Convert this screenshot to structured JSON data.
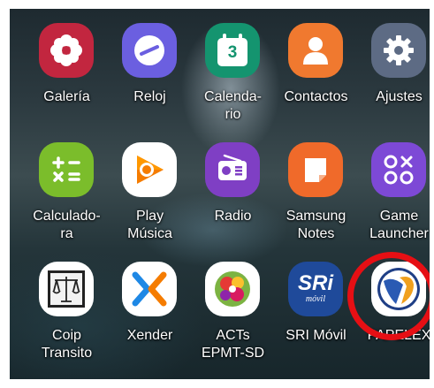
{
  "apps": [
    {
      "label": "Galería",
      "icon": "flower-icon",
      "bg": "#c2263f"
    },
    {
      "label": "Reloj",
      "icon": "clock-icon",
      "bg": "#6b5fe0"
    },
    {
      "label": "Calenda-\nrio",
      "icon": "calendar-icon",
      "bg": "#14946f"
    },
    {
      "label": "Contactos",
      "icon": "person-icon",
      "bg": "#f0792f"
    },
    {
      "label": "Ajustes",
      "icon": "gear-icon",
      "bg": "#5d6b84"
    },
    {
      "label": "Calculado-\nra",
      "icon": "calculator-icon",
      "bg": "#7bbd2b"
    },
    {
      "label": "Play\nMúsica",
      "icon": "play-music-icon",
      "bg": "#ffffff"
    },
    {
      "label": "Radio",
      "icon": "radio-icon",
      "bg": "#7f3fc4"
    },
    {
      "label": "Samsung\nNotes",
      "icon": "notes-icon",
      "bg": "#f06a2a"
    },
    {
      "label": "Game\nLauncher",
      "icon": "game-launcher-icon",
      "bg": "#7d49d6"
    },
    {
      "label": "Coip\nTransito",
      "icon": "scales-icon",
      "bg": "#ffffff"
    },
    {
      "label": "Xender",
      "icon": "xender-icon",
      "bg": "#ffffff"
    },
    {
      "label": "ACTs\nEPMT-SD",
      "icon": "acts-icon",
      "bg": "#ffffff"
    },
    {
      "label": "SRI Móvil",
      "icon": "sri-icon",
      "bg": "#1f4a9a"
    },
    {
      "label": "PAPELEX",
      "icon": "papelex-icon",
      "bg": "#ffffff"
    }
  ],
  "icon_text": {
    "calendar_day": "3",
    "sri_logo": "SRi",
    "sri_sub": "móvil"
  },
  "highlight": {
    "target": "PAPELEX",
    "color": "#e60f14"
  }
}
